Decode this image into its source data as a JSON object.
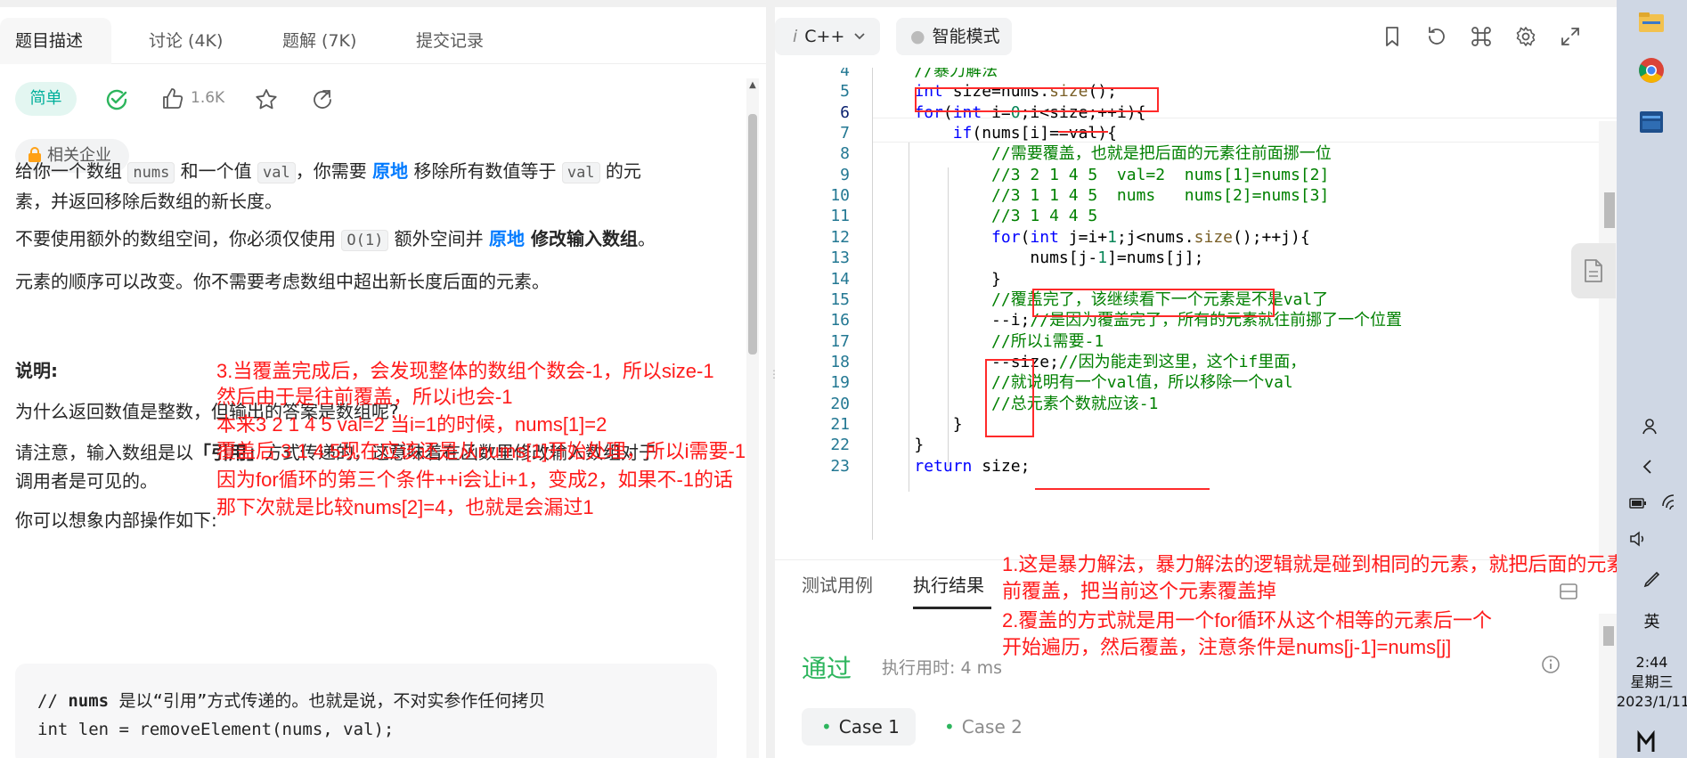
{
  "left_tabs": {
    "description": "题目描述",
    "discuss": "讨论 (4K)",
    "solution": "题解 (7K)",
    "submissions": "提交记录"
  },
  "meta": {
    "difficulty": "简单",
    "likes": "1.6K",
    "company_tag": "相关企业"
  },
  "problem": {
    "p1_a": "给你一个数组 ",
    "p1_code1": "nums",
    "p1_b": " 和一个值 ",
    "p1_code2": "val",
    "p1_c": "，你需要 ",
    "p1_hl": "原地",
    "p1_d": " 移除所有数值等于 ",
    "p1_code3": "val",
    "p1_e": " 的元",
    "p1_f": "素，并返回移除后数组的新长度。",
    "p2_a": "不要使用额外的数组空间，你必须仅使用 ",
    "p2_code": "O(1)",
    "p2_b": " 额外空间并 ",
    "p2_hl": "原地",
    "p2_bold": " 修改输入数组",
    "p2_c": "。",
    "p3": "元素的顺序可以改变。你不需要考虑数组中超出新长度后面的元素。",
    "note_title": "说明:",
    "p4": "为什么返回数值是整数，但输出的答案是数组呢?",
    "p5_a": "请注意，输入数组是以",
    "p5_bold": "「引用」",
    "p5_b": "方式传递的，这意味着在函数里修改输入数组对于",
    "p5_c": "调用者是可见的。",
    "p6": "你可以想象内部操作如下:",
    "code_line1_a": "// ",
    "code_line1_bold": "nums",
    "code_line1_b": " 是以“引用”方式传递的。也就是说，不对实参作任何拷贝",
    "code_line2": "int len = removeElement(nums, val);"
  },
  "editor": {
    "language": "C++",
    "mode": "智能模式",
    "lines": [
      {
        "n": "4",
        "segs": [
          {
            "t": "    //暴力解法",
            "c": "cm"
          }
        ]
      },
      {
        "n": "5",
        "segs": [
          {
            "t": "    ",
            "c": ""
          },
          {
            "t": "int",
            "c": "kw"
          },
          {
            "t": " size=nums.",
            "c": ""
          },
          {
            "t": "size",
            "c": "fn"
          },
          {
            "t": "();",
            "c": ""
          }
        ]
      },
      {
        "n": "6",
        "segs": [
          {
            "t": "    ",
            "c": ""
          },
          {
            "t": "for",
            "c": "kw"
          },
          {
            "t": "(",
            "c": ""
          },
          {
            "t": "int",
            "c": "kw"
          },
          {
            "t": " i=",
            "c": ""
          },
          {
            "t": "0",
            "c": "num"
          },
          {
            "t": ";i<size;++i){",
            "c": ""
          }
        ]
      },
      {
        "n": "7",
        "segs": [
          {
            "t": "        ",
            "c": ""
          },
          {
            "t": "if",
            "c": "kw"
          },
          {
            "t": "(nums[i]==val){",
            "c": ""
          }
        ]
      },
      {
        "n": "8",
        "segs": [
          {
            "t": "            //需要覆盖，也就是把后面的元素往前面挪一位",
            "c": "cm"
          }
        ]
      },
      {
        "n": "9",
        "segs": [
          {
            "t": "            //3 2 1 4 5  val=2  nums[1]=nums[2]",
            "c": "cm"
          }
        ]
      },
      {
        "n": "10",
        "segs": [
          {
            "t": "            //3 1 1 4 5  nums   nums[2]=nums[3]",
            "c": "cm"
          }
        ]
      },
      {
        "n": "11",
        "segs": [
          {
            "t": "            //3 1 4 4 5",
            "c": "cm"
          }
        ]
      },
      {
        "n": "12",
        "segs": [
          {
            "t": "            ",
            "c": ""
          },
          {
            "t": "for",
            "c": "kw"
          },
          {
            "t": "(",
            "c": ""
          },
          {
            "t": "int",
            "c": "kw"
          },
          {
            "t": " j=i+",
            "c": ""
          },
          {
            "t": "1",
            "c": "num"
          },
          {
            "t": ";j<nums.",
            "c": ""
          },
          {
            "t": "size",
            "c": "fn"
          },
          {
            "t": "();++j){",
            "c": ""
          }
        ]
      },
      {
        "n": "13",
        "segs": [
          {
            "t": "                nums[j-",
            "c": ""
          },
          {
            "t": "1",
            "c": "num"
          },
          {
            "t": "]=nums[j];",
            "c": ""
          }
        ]
      },
      {
        "n": "14",
        "segs": [
          {
            "t": "            }",
            "c": ""
          }
        ]
      },
      {
        "n": "15",
        "segs": [
          {
            "t": "            //覆盖完了，该继续看下一个元素是不是val了",
            "c": "cm"
          }
        ]
      },
      {
        "n": "16",
        "segs": [
          {
            "t": "            --i;",
            "c": ""
          },
          {
            "t": "//是因为覆盖完了，所有的元素就往前挪了一个位置",
            "c": "cm"
          }
        ]
      },
      {
        "n": "17",
        "segs": [
          {
            "t": "            //所以i需要-1",
            "c": "cm"
          }
        ]
      },
      {
        "n": "18",
        "segs": [
          {
            "t": "            --size;",
            "c": ""
          },
          {
            "t": "//因为能走到这里，这个if里面，",
            "c": "cm"
          }
        ]
      },
      {
        "n": "19",
        "segs": [
          {
            "t": "            //就说明有一个val值，所以移除一个val",
            "c": "cm"
          }
        ]
      },
      {
        "n": "20",
        "segs": [
          {
            "t": "            //总元素个数就应该-1",
            "c": "cm"
          }
        ]
      },
      {
        "n": "21",
        "segs": [
          {
            "t": "        }",
            "c": ""
          }
        ]
      },
      {
        "n": "22",
        "segs": [
          {
            "t": "    }",
            "c": ""
          }
        ]
      },
      {
        "n": "23",
        "segs": [
          {
            "t": "    ",
            "c": ""
          },
          {
            "t": "return",
            "c": "kw"
          },
          {
            "t": " size;",
            "c": ""
          }
        ]
      }
    ]
  },
  "console": {
    "tab_testcase": "测试用例",
    "tab_result": "执行结果",
    "status": "通过",
    "runtime": "执行用时: 4 ms",
    "case1": "Case 1",
    "case2": "Case 2"
  },
  "annotations": {
    "a1": "3.当覆盖完成后，会发现整体的数组个数会-1，所以size-1",
    "a2": "然后由于是往前覆盖，所以i也会-1",
    "a3": "本来3 2 1 4 5 val=2 当i=1的时候，nums[1]=2",
    "a4": "覆盖后 3 1 4 5现在应该还是从nums[1]开始处理，所以i需要-1",
    "a5": "因为for循环的第三个条件++i会让i+1，变成2，如果不-1的话",
    "a6": "那下次就是比较nums[2]=4，也就是会漏过1",
    "b1": "1.这是暴力解法，暴力解法的逻辑就是碰到相同的元素，就把后面的元素往",
    "b2": "前覆盖，把当前这个元素覆盖掉",
    "b3": "2.覆盖的方式就是用一个for循环从这个相等的元素后一个",
    "b4": "开始遍历，然后覆盖，注意条件是nums[j-1]=nums[j]"
  },
  "taskbar": {
    "ime": "英",
    "time": "2:44",
    "weekday": "星期三",
    "date": "2023/1/11"
  }
}
